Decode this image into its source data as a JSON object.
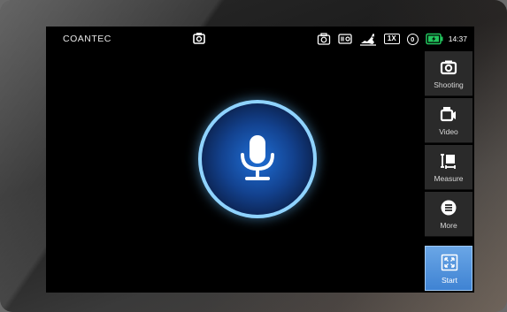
{
  "device": {
    "brand": "COANTEC"
  },
  "status": {
    "icons": [
      "camera-icon",
      "record-icon",
      "rabbit-speed-icon",
      "zoom-indicator",
      "zero-indicator",
      "battery-charging-icon"
    ],
    "zoom": "1X",
    "zero": "0",
    "time": "14:37"
  },
  "sidebar": {
    "items": [
      {
        "label": "Shooting",
        "icon": "camera-icon"
      },
      {
        "label": "Video",
        "icon": "video-icon"
      },
      {
        "label": "Measure",
        "icon": "measure-icon"
      },
      {
        "label": "More",
        "icon": "more-icon"
      },
      {
        "label": "Start",
        "icon": "fullscreen-icon",
        "active": true
      }
    ]
  },
  "voice": {
    "icon": "microphone-icon"
  },
  "colors": {
    "accent": "#4a8fdc",
    "mic_ring": "#8fd3ff",
    "battery": "#22c55e"
  }
}
